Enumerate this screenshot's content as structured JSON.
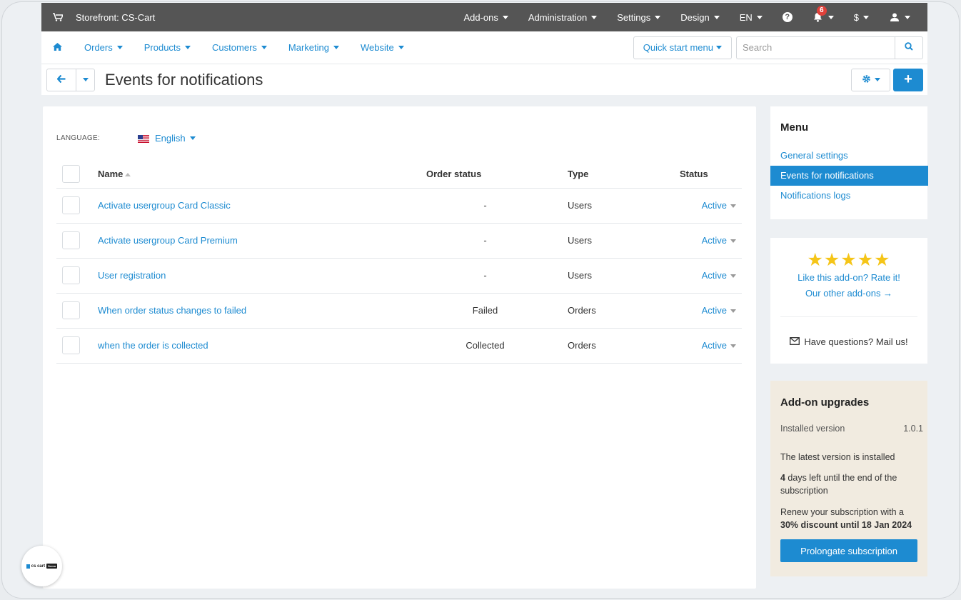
{
  "topbar": {
    "storefront": "Storefront: CS-Cart",
    "menu": [
      "Add-ons",
      "Administration",
      "Settings",
      "Design",
      "EN"
    ],
    "notification_count": "6",
    "currency": "$"
  },
  "nav": {
    "items": [
      "Orders",
      "Products",
      "Customers",
      "Marketing",
      "Website"
    ],
    "quick_start": "Quick start menu",
    "search_placeholder": "Search"
  },
  "page": {
    "title": "Events for notifications"
  },
  "language": {
    "label": "LANGUAGE:",
    "value": "English"
  },
  "table": {
    "headers": {
      "name": "Name",
      "order_status": "Order status",
      "type": "Type",
      "status": "Status"
    },
    "rows": [
      {
        "name": "Activate usergroup Card Classic",
        "order_status": "-",
        "type": "Users",
        "status": "Active"
      },
      {
        "name": "Activate usergroup Card Premium",
        "order_status": "-",
        "type": "Users",
        "status": "Active"
      },
      {
        "name": "User registration",
        "order_status": "-",
        "type": "Users",
        "status": "Active"
      },
      {
        "name": "When order status changes to failed",
        "order_status": "Failed",
        "type": "Orders",
        "status": "Active"
      },
      {
        "name": "when the order is collected",
        "order_status": "Collected",
        "type": "Orders",
        "status": "Active"
      }
    ]
  },
  "sidebar": {
    "menu_title": "Menu",
    "menu_items": [
      "General settings",
      "Events for notifications",
      "Notifications logs"
    ],
    "active_index": 1,
    "rating": {
      "stars": "★★★★★",
      "rate_text": "Like this add-on? Rate it!",
      "other_text": "Our other add-ons →",
      "mail_text": "Have questions? Mail us!"
    },
    "upgrades": {
      "title": "Add-on upgrades",
      "installed_label": "Installed version",
      "installed_value": "1.0.1",
      "latest_text": "The latest version is installed",
      "days_number": "4",
      "days_text": " days left until the end of the subscription",
      "renew_text": "Renew your subscription with a ",
      "renew_bold": "30% discount until 18 Jan 2024",
      "button": "Prolongate subscription"
    }
  },
  "logo": {
    "brand": "cs cart",
    "tag": "Demo"
  },
  "colors": {
    "accent": "#1d8bd1",
    "topbar": "#555555",
    "star": "#f5c518",
    "upgrade_bg": "#f1ebe0"
  }
}
